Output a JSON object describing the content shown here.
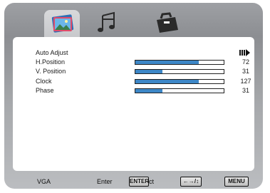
{
  "tabs": [
    {
      "name": "picture",
      "icon": "picture-icon",
      "active": true
    },
    {
      "name": "audio",
      "icon": "music-note-icon",
      "active": false
    },
    {
      "name": "setup",
      "icon": "toolbox-icon",
      "active": false
    }
  ],
  "menu": {
    "items": [
      {
        "label": "Auto Adjust",
        "value": "",
        "level": null
      },
      {
        "label": "H.Position",
        "value": "72",
        "level": 0.72
      },
      {
        "label": "V. Position",
        "value": "31",
        "level": 0.31
      },
      {
        "label": "Clock",
        "value": "127",
        "level": 0.72
      },
      {
        "label": "Phase",
        "value": "31",
        "level": 0.31
      }
    ]
  },
  "footer": {
    "source": "VGA",
    "enter_label": "Enter",
    "enter_key": "ENTER",
    "select_suffix": "ct",
    "select_key": "←→/↕",
    "menu_key": "MENU"
  },
  "colors": {
    "accent": "#3d87c7",
    "panel": "#9ea0a4"
  }
}
